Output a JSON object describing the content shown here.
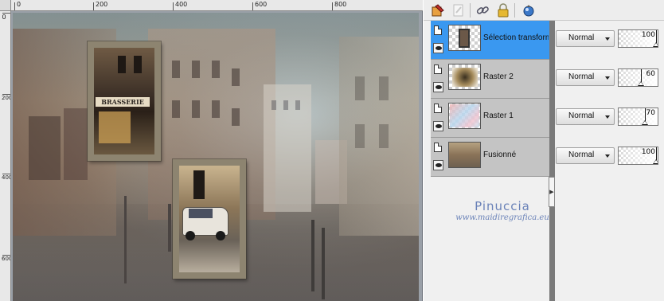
{
  "rulers": {
    "top_labels": [
      "0",
      "200",
      "400",
      "600",
      "800"
    ],
    "left_labels": [
      "0",
      "200",
      "400",
      "600"
    ]
  },
  "layers_panel": {
    "toolbar": {
      "icons": [
        "new-raster-layer-icon",
        "new-adjustment-layer-icon",
        "link-icon",
        "lock-icon",
        "group-icon"
      ]
    },
    "layers": [
      {
        "name": "Sélection transformé",
        "selected": true,
        "visible": true,
        "blend_mode": "Normal",
        "opacity": 100
      },
      {
        "name": "Raster 2",
        "selected": false,
        "visible": true,
        "blend_mode": "Normal",
        "opacity": 60
      },
      {
        "name": "Raster 1",
        "selected": false,
        "visible": true,
        "blend_mode": "Normal",
        "opacity": 70
      },
      {
        "name": "Fusionné",
        "selected": false,
        "visible": true,
        "blend_mode": "Normal",
        "opacity": 100
      }
    ]
  },
  "watermark": {
    "title": "Pinuccia",
    "url": "www.maidiregrafica.eu"
  },
  "colors": {
    "selected_row": "#3a98f0",
    "watermark": "#6a82b8"
  }
}
